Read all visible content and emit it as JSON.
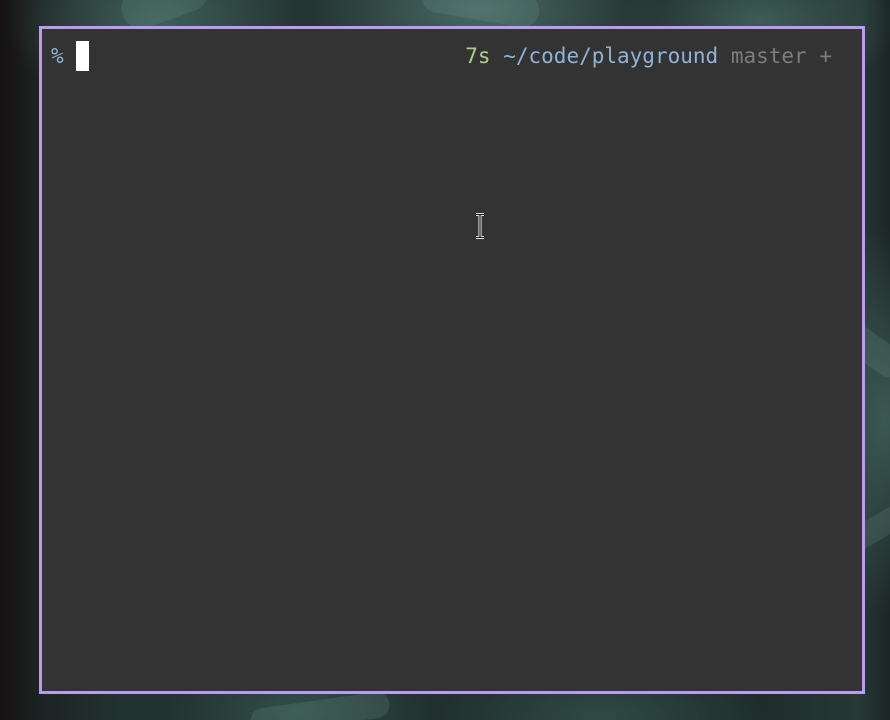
{
  "terminal": {
    "prompt_symbol": "%",
    "right_prompt": {
      "elapsed": "7s",
      "cwd": "~/code/playground",
      "branch": "master",
      "dirty_marker": "+"
    }
  },
  "colors": {
    "window_border": "#b99bf0",
    "terminal_background": "#333333",
    "prompt_symbol": "#8fb3d9",
    "elapsed": "#b5cd8c",
    "cwd": "#8fb3d9",
    "branch": "#7d7d7d",
    "cursor": "#ffffff"
  },
  "icons": {
    "pointer": "text-ibeam-cursor-icon"
  }
}
